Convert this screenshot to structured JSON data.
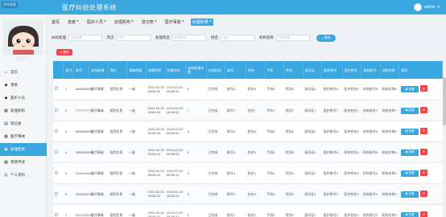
{
  "app": {
    "badge": "学号信息",
    "title": "医疗纠纷处理系统",
    "user": "admin"
  },
  "sidebar": {
    "username": "admin",
    "items": [
      {
        "label": "首页",
        "icon": "home-icon",
        "glyph": "⌂"
      },
      {
        "label": "患者",
        "icon": "user-icon",
        "glyph": "◆"
      },
      {
        "label": "医护人员",
        "icon": "doctor-icon",
        "glyph": "◆"
      },
      {
        "label": "处理机构",
        "icon": "building-icon",
        "glyph": "▦"
      },
      {
        "label": "登记表",
        "icon": "form-icon",
        "glyph": "▤"
      },
      {
        "label": "医疗事故",
        "icon": "alert-icon",
        "glyph": "▦"
      },
      {
        "label": "处理结果",
        "icon": "result-icon",
        "glyph": "◉"
      },
      {
        "label": "患者申述",
        "icon": "appeal-icon",
        "glyph": "▦"
      },
      {
        "label": "个人资料",
        "icon": "profile-icon",
        "glyph": "◎"
      }
    ]
  },
  "tabs": [
    {
      "label": "首页",
      "closable": false
    },
    {
      "label": "患者",
      "closable": true
    },
    {
      "label": "医护人员",
      "closable": true
    },
    {
      "label": "处理机构",
      "closable": true
    },
    {
      "label": "登记表",
      "closable": true
    },
    {
      "label": "医疗事故",
      "closable": true
    },
    {
      "label": "处理结果",
      "closable": true
    }
  ],
  "filters": [
    {
      "label": "纠纷处理",
      "placeholder": "纠纷处理"
    },
    {
      "label": "院方",
      "placeholder": "院方"
    },
    {
      "label": "处理状态",
      "placeholder": "处理状态"
    },
    {
      "label": "姓名",
      "placeholder": "姓名"
    },
    {
      "label": "机构名称",
      "placeholder": "机构名称"
    }
  ],
  "query_label": "查询",
  "delete_label": "删除",
  "table": {
    "columns": [
      "索引",
      "账号",
      "纠纷处理",
      "院方",
      "事故等级",
      "处理时间",
      "结束时间",
      "纠纷处理次数",
      "处理状态",
      "账号",
      "姓名",
      "手机",
      "性别",
      "身份证",
      "医护账号",
      "医护姓名",
      "机构账号",
      "机构名称",
      "操作"
    ],
    "view_label": "查看",
    "rows": [
      {
        "idx": "1",
        "account": "6666666666",
        "dispute": "医疗事故",
        "side": "医院负责",
        "level": "一级",
        "t1": "2024-02-02 08:56:42",
        "t2": "2024-02-02 08:56:42",
        "count": "8",
        "status": "已完成",
        "acc2": "账号8",
        "name": "姓名8",
        "phone": "手机8",
        "sex": "性别8",
        "id": "身份证8",
        "dacc": "医护账号8",
        "dname": "医护姓名8",
        "oacc": "机构账号8",
        "oname": "机构名称8"
      },
      {
        "idx": "2",
        "account": "7777777777",
        "dispute": "医疗事故",
        "side": "医院负责",
        "level": "一级",
        "t1": "2024-02-02 08:56:42",
        "t2": "2024-02-02 08:56:42",
        "count": "7",
        "status": "已完成",
        "acc2": "账号7",
        "name": "姓名7",
        "phone": "手机7",
        "sex": "性别7",
        "id": "身份证7",
        "dacc": "医护账号7",
        "dname": "医护姓名7",
        "oacc": "机构账号7",
        "oname": "机构名称7"
      },
      {
        "idx": "3",
        "account": "6666666666",
        "dispute": "医疗事故",
        "side": "医院负责",
        "level": "一级",
        "t1": "2024-02-02 08:56:42",
        "t2": "2024-02-02 08:56:42",
        "count": "6",
        "status": "已完成",
        "acc2": "账号6",
        "name": "姓名6",
        "phone": "手机6",
        "sex": "性别6",
        "id": "身份证6",
        "dacc": "医护账号6",
        "dname": "医护姓名6",
        "oacc": "机构账号6",
        "oname": "机构名称6"
      },
      {
        "idx": "4",
        "account": "5555555555",
        "dispute": "医疗事故",
        "side": "医院负责",
        "level": "一级",
        "t1": "2024-02-02 08:56:42",
        "t2": "2024-02-02 08:56:42",
        "count": "5",
        "status": "已完成",
        "acc2": "账号5",
        "name": "姓名5",
        "phone": "手机5",
        "sex": "性别5",
        "id": "身份证5",
        "dacc": "医护账号5",
        "dname": "医护姓名5",
        "oacc": "机构账号5",
        "oname": "机构名称5"
      },
      {
        "idx": "5",
        "account": "4444444444",
        "dispute": "医疗事故",
        "side": "医院负责",
        "level": "一级",
        "t1": "2024-02-02 08:56:42",
        "t2": "2024-02-02 08:56:42",
        "count": "4",
        "status": "已完成",
        "acc2": "账号4",
        "name": "姓名4",
        "phone": "手机4",
        "sex": "性别4",
        "id": "身份证4",
        "dacc": "医护账号4",
        "dname": "医护姓名4",
        "oacc": "机构账号4",
        "oname": "机构名称4"
      },
      {
        "idx": "6",
        "account": "3333333333",
        "dispute": "医疗事故",
        "side": "医院负责",
        "level": "一级",
        "t1": "2024-02-02 08:56:42",
        "t2": "2024-02-02 08:56:42",
        "count": "3",
        "status": "已完成",
        "acc2": "账号3",
        "name": "姓名3",
        "phone": "手机3",
        "sex": "性别3",
        "id": "身份证3",
        "dacc": "医护账号3",
        "dname": "医护姓名3",
        "oacc": "机构账号3",
        "oname": "机构名称3"
      },
      {
        "idx": "7",
        "account": "2222222222",
        "dispute": "医疗事故",
        "side": "医院负责",
        "level": "一级",
        "t1": "2024-02-02 08:56:42",
        "t2": "2024-02-02 08:56:42",
        "count": "2",
        "status": "已完成",
        "acc2": "账号2",
        "name": "姓名2",
        "phone": "手机2",
        "sex": "性别2",
        "id": "身份证2",
        "dacc": "医护账号2",
        "dname": "医护姓名2",
        "oacc": "机构账号2",
        "oname": "机构名称2"
      }
    ]
  },
  "colors": {
    "primary": "#3aa7e0",
    "danger": "#f0474c",
    "sidebar_bg": "#f4f6f8"
  }
}
